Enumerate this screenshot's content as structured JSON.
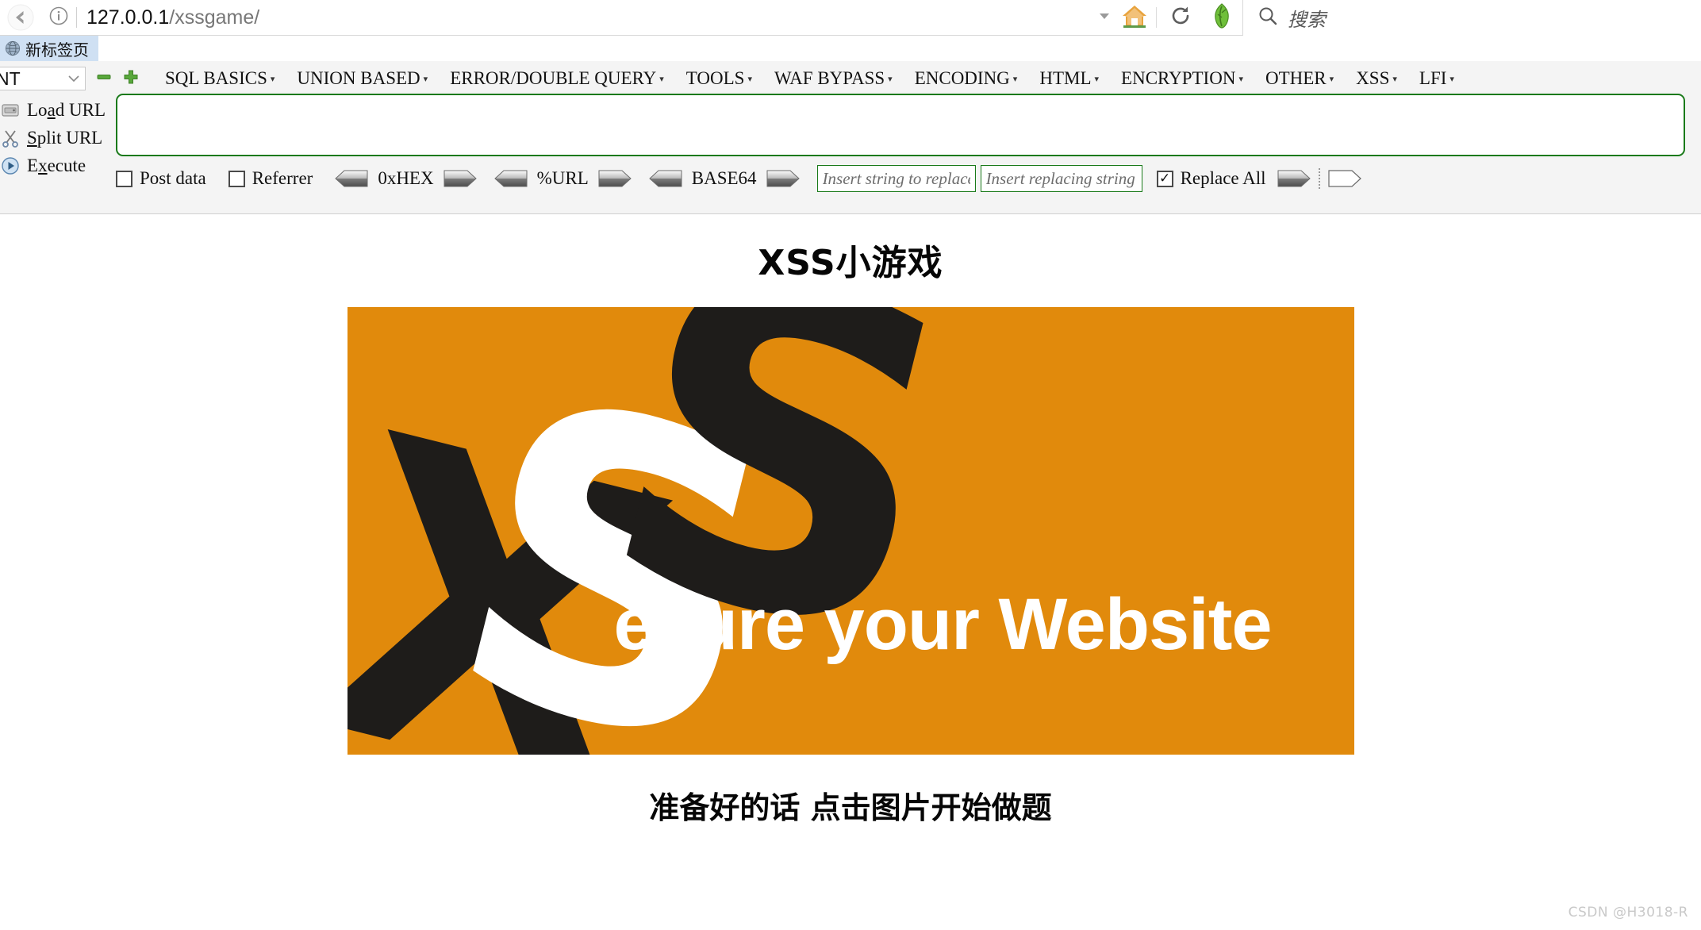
{
  "browser": {
    "back_icon": "back-arrow-icon",
    "identity_icon": "info-circle-icon",
    "url_host": "127.0.0.1",
    "url_path": "/xssgame/",
    "dropmarker_icon": "chevron-down-icon",
    "home_icon": "home-icon",
    "reload_icon": "reload-icon",
    "extension_icon": "hackbar-extension-icon",
    "search_icon": "search-icon",
    "search_placeholder": "搜索"
  },
  "tabs": [
    {
      "favicon": "globe-icon",
      "label": "新标签页"
    }
  ],
  "hackbar": {
    "selector": {
      "value": "NT",
      "chevron": "chevron-down-icon"
    },
    "remove_icon": "minus-icon",
    "add_icon": "plus-icon",
    "menus": [
      {
        "label": "SQL BASICS",
        "caret": "▾"
      },
      {
        "label": "UNION BASED",
        "caret": "▾"
      },
      {
        "label": "ERROR/DOUBLE QUERY",
        "caret": "▾"
      },
      {
        "label": "TOOLS",
        "caret": "▾"
      },
      {
        "label": "WAF BYPASS",
        "caret": "▾"
      },
      {
        "label": "ENCODING",
        "caret": "▾"
      },
      {
        "label": "HTML",
        "caret": "▾"
      },
      {
        "label": "ENCRYPTION",
        "caret": "▾"
      },
      {
        "label": "OTHER",
        "caret": "▾"
      },
      {
        "label": "XSS",
        "caret": "▾"
      },
      {
        "label": "LFI",
        "caret": "▾"
      }
    ],
    "actions": [
      {
        "icon": "load-url-icon",
        "pre": "Lo",
        "key": "a",
        "post": "d URL"
      },
      {
        "icon": "split-url-icon",
        "pre": "",
        "key": "S",
        "post": "plit URL"
      },
      {
        "icon": "execute-icon",
        "pre": "E",
        "key": "x",
        "post": "ecute"
      }
    ],
    "request_textarea": {
      "value": "",
      "border_color": "#1a7a1a"
    },
    "options": {
      "post_data": {
        "label": "Post data",
        "checked": false
      },
      "referrer": {
        "label": "Referrer",
        "checked": false
      },
      "encoders": [
        {
          "label": "0xHEX",
          "decode_icon": "decode-arrow-left-icon",
          "encode_icon": "encode-arrow-right-icon"
        },
        {
          "label": "%URL",
          "decode_icon": "decode-arrow-left-icon",
          "encode_icon": "encode-arrow-right-icon"
        },
        {
          "label": "BASE64",
          "decode_icon": "decode-arrow-left-icon",
          "encode_icon": "encode-arrow-right-icon"
        }
      ],
      "search_string": {
        "placeholder": "Insert string to replace",
        "value": ""
      },
      "replace_string": {
        "placeholder": "Insert replacing string",
        "value": ""
      },
      "replace_all": {
        "label": "Replace All",
        "checked": true
      },
      "replace_button_icon": "filled-arrow-right-icon",
      "clear_button_icon": "outline-arrow-right-icon"
    }
  },
  "page": {
    "title": "XSS小游戏",
    "caption": "准备好的话 点击图片开始做题",
    "banner": {
      "alt": "xss-secure-your-website-banner",
      "background_color": "#e18a0c",
      "dark_color": "#1e1c1a",
      "light_color": "#ffffff",
      "letters": [
        "X",
        "S",
        "S"
      ],
      "tagline": "ecure your Website"
    },
    "watermark": "CSDN @H3018-R"
  }
}
